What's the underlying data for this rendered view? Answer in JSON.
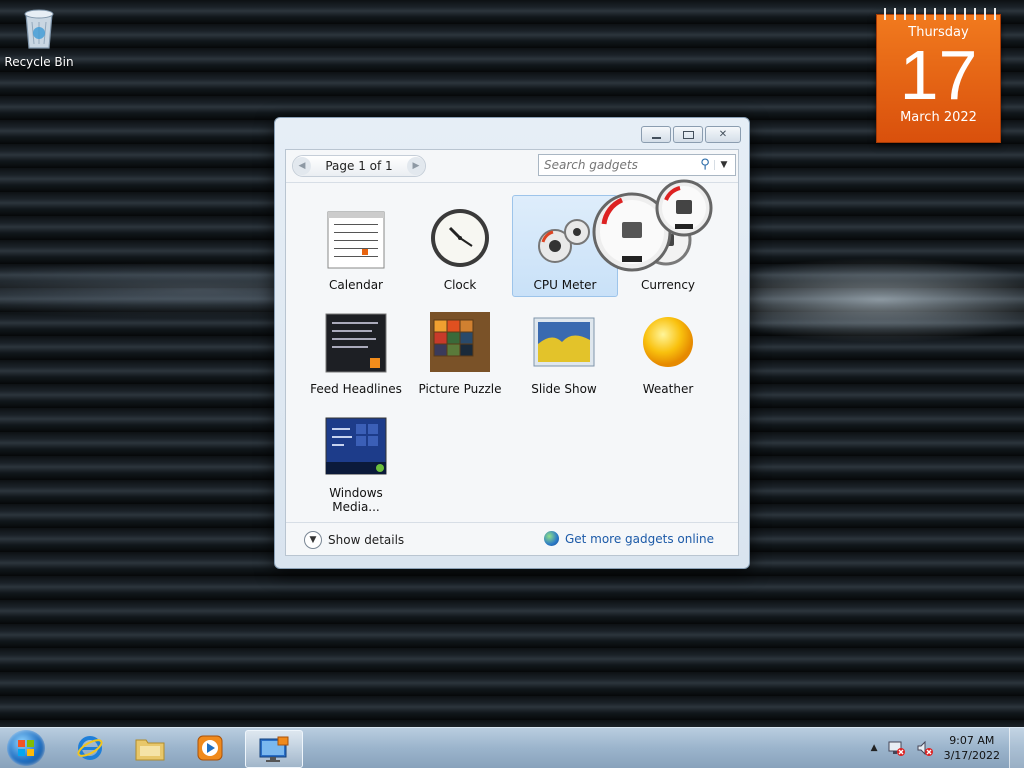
{
  "desktop": {
    "recycle_bin_label": "Recycle Bin"
  },
  "calendar_gadget": {
    "weekday": "Thursday",
    "day": "17",
    "month_year": "March 2022"
  },
  "gadgets_window": {
    "pager_text": "Page 1 of 1",
    "search_placeholder": "Search gadgets",
    "gadgets": [
      {
        "label": "Calendar",
        "icon": "calendar-icon"
      },
      {
        "label": "Clock",
        "icon": "clock-icon"
      },
      {
        "label": "CPU Meter",
        "icon": "cpu-meter-icon",
        "selected": true
      },
      {
        "label": "Currency",
        "icon": "currency-icon"
      },
      {
        "label": "Feed Headlines",
        "icon": "feed-headlines-icon"
      },
      {
        "label": "Picture Puzzle",
        "icon": "picture-puzzle-icon"
      },
      {
        "label": "Slide Show",
        "icon": "slide-show-icon"
      },
      {
        "label": "Weather",
        "icon": "weather-icon"
      },
      {
        "label": "Windows Media...",
        "icon": "windows-media-center-icon"
      }
    ],
    "show_details_label": "Show details",
    "get_more_label": "Get more gadgets online"
  },
  "taskbar": {
    "pinned": [
      "internet-explorer-icon",
      "windows-explorer-icon",
      "media-player-icon",
      "desktop-gadgets-icon"
    ],
    "time": "9:07 AM",
    "date": "3/17/2022"
  },
  "colors": {
    "calendar_orange": "#e8640f",
    "link_blue": "#1c5aa8",
    "selection": "#c9e1f8"
  }
}
